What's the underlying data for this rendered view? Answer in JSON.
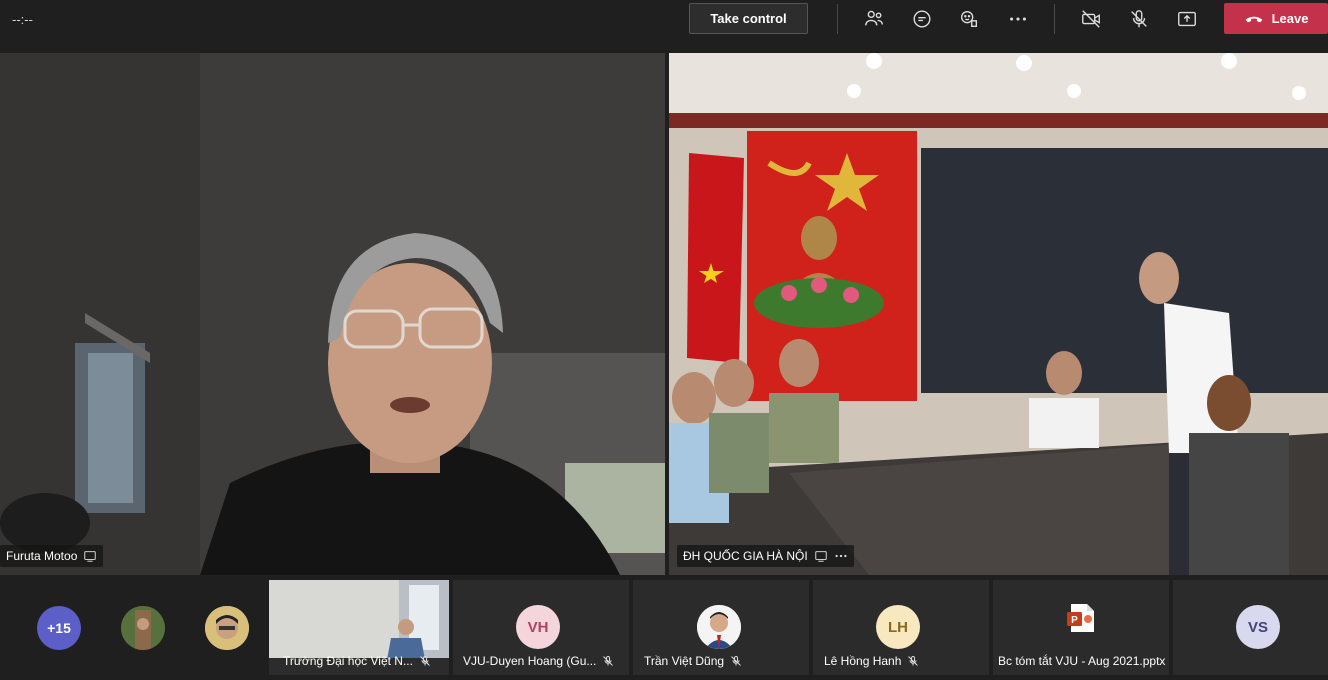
{
  "topbar": {
    "timer": "--:--",
    "take_control_label": "Take control",
    "leave_label": "Leave"
  },
  "tiles": {
    "main_left": {
      "name": "Furuta Motoo"
    },
    "main_right": {
      "name": "ĐH QUỐC GIA HÀ NỘI"
    }
  },
  "strip": {
    "overflow_count": "+15",
    "items": [
      {
        "name": "Trường Đại học Việt N..."
      },
      {
        "initials": "VH",
        "name": "VJU-Duyen Hoang (Gu..."
      },
      {
        "name": "Trần Việt Dũng"
      },
      {
        "initials": "LH",
        "name": "Lê Hồng Hanh"
      },
      {
        "name": "Bc tóm tắt VJU - Aug 2021.pptx"
      },
      {
        "initials": "VS"
      }
    ]
  },
  "colors": {
    "leave": "#c4314b",
    "overflow_badge": "#5b5fc7",
    "avatar_vh": "#f5d5dc",
    "avatar_lh": "#f8e8c0",
    "avatar_vs": "#d8d8ef"
  }
}
